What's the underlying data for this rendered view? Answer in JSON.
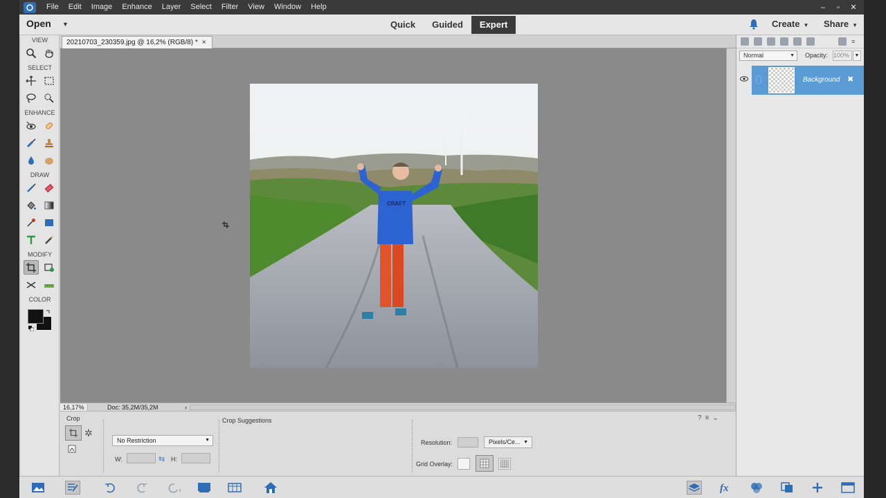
{
  "menubar": {
    "items": [
      "File",
      "Edit",
      "Image",
      "Enhance",
      "Layer",
      "Select",
      "Filter",
      "View",
      "Window",
      "Help"
    ],
    "controls": [
      "–",
      "▫",
      "✕"
    ]
  },
  "topbar": {
    "open_label": "Open",
    "modes": [
      "Quick",
      "Guided",
      "Expert"
    ],
    "active_mode": "Expert",
    "create_label": "Create",
    "share_label": "Share"
  },
  "toolbox": {
    "sections": {
      "view": "VIEW",
      "select": "SELECT",
      "enhance": "ENHANCE",
      "draw": "DRAW",
      "modify": "MODIFY",
      "color": "COLOR"
    },
    "foreground_color": "#111111",
    "background_color": "#111111"
  },
  "document": {
    "tab_title": "20210703_230359.jpg @ 16,2% (RGB/8) *",
    "tab_close": "×",
    "zoom": "16,17%",
    "doc_size": "Doc: 35,2M/35,2M"
  },
  "layers": {
    "blend_mode": "Normal",
    "opacity_label": "Opacity:",
    "opacity_value": "100%",
    "layer_name": "Background"
  },
  "tool_options": {
    "title": "Crop",
    "aspect_select": "No Restriction",
    "width_label": "W:",
    "height_label": "H:",
    "crop_suggestions_label": "Crop Suggestions",
    "resolution_label": "Resolution:",
    "resolution_unit": "Pixels/Ce...",
    "grid_overlay_label": "Grid Overlay:"
  },
  "colors": {
    "accent": "#2e6db5",
    "layer_selected": "#5b9bd5",
    "canvas_bg": "#8a8a8a"
  }
}
